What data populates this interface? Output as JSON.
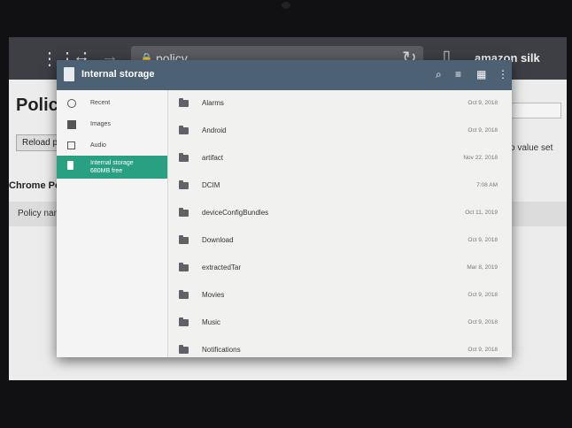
{
  "browser": {
    "address": "policy",
    "brand": "amazon silk"
  },
  "page": {
    "title": "Polic",
    "reload_label": "Reload p",
    "section": "Chrome Po",
    "column_header": "Policy nam",
    "no_value": "o value set"
  },
  "dialog": {
    "title": "Internal storage",
    "roots": [
      {
        "label": "Recent",
        "icon": "clock-icon"
      },
      {
        "label": "Images",
        "icon": "image-icon"
      },
      {
        "label": "Audio",
        "icon": "audio-icon"
      },
      {
        "label": "Internal storage",
        "sub": "680MB free",
        "icon": "sd-card-icon"
      }
    ],
    "files": [
      {
        "name": "Alarms",
        "date": "Oct 9, 2018"
      },
      {
        "name": "Android",
        "date": "Oct 9, 2018"
      },
      {
        "name": "artifact",
        "date": "Nov 22, 2018"
      },
      {
        "name": "DCIM",
        "date": "7:08 AM"
      },
      {
        "name": "deviceConfigBundles",
        "date": "Oct 11, 2019"
      },
      {
        "name": "Download",
        "date": "Oct 9, 2018"
      },
      {
        "name": "extractedTar",
        "date": "Mar 8, 2019"
      },
      {
        "name": "Movies",
        "date": "Oct 9, 2018"
      },
      {
        "name": "Music",
        "date": "Oct 9, 2018"
      },
      {
        "name": "Notifications",
        "date": "Oct 9, 2018"
      }
    ]
  },
  "colors": {
    "header": "#4c6173",
    "accent": "#2aa083"
  }
}
